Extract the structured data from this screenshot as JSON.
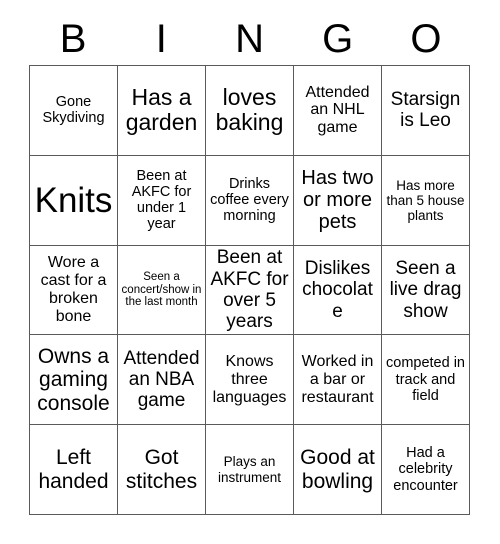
{
  "card": {
    "title_letters": [
      "B",
      "I",
      "N",
      "G",
      "O"
    ],
    "rows": 5,
    "columns": 5,
    "colors": {
      "background": "#ffffff",
      "text": "#000000",
      "grid_line": "#5a5a5a"
    },
    "grid": [
      [
        {
          "text": "Gone Skydiving",
          "size": "xs"
        },
        {
          "text": "Has a garden",
          "size": "xl"
        },
        {
          "text": "loves baking",
          "size": "xl"
        },
        {
          "text": "Attended an NHL game",
          "size": "sm"
        },
        {
          "text": "Starsign is Leo",
          "size": "md"
        }
      ],
      [
        {
          "text": "Knits",
          "size": "xxl"
        },
        {
          "text": "Been at AKFC for under 1 year",
          "size": "xs"
        },
        {
          "text": "Drinks coffee every morning",
          "size": "xs"
        },
        {
          "text": "Has two or more pets",
          "size": "ml"
        },
        {
          "text": "Has more than 5 house plants",
          "size": "xxs"
        }
      ],
      [
        {
          "text": "Wore a cast for a broken bone",
          "size": "sm"
        },
        {
          "text": "Seen a concert/show in the last month",
          "size": "tiny"
        },
        {
          "text": "Been at AKFC for over 5 years",
          "size": "md"
        },
        {
          "text": "Dislikes chocolate",
          "size": "md"
        },
        {
          "text": "Seen a live drag show",
          "size": "md"
        }
      ],
      [
        {
          "text": "Owns a gaming console",
          "size": "lg"
        },
        {
          "text": "Attended an NBA game",
          "size": "md"
        },
        {
          "text": "Knows three languages",
          "size": "sm"
        },
        {
          "text": "Worked in a bar or restaurant",
          "size": "sm"
        },
        {
          "text": "competed in track and field",
          "size": "xs"
        }
      ],
      [
        {
          "text": "Left handed",
          "size": "lg"
        },
        {
          "text": "Got stitches",
          "size": "lg"
        },
        {
          "text": "Plays an instrument",
          "size": "xxs"
        },
        {
          "text": "Good at bowling",
          "size": "lg"
        },
        {
          "text": "Had a celebrity encounter",
          "size": "xs"
        }
      ]
    ]
  }
}
